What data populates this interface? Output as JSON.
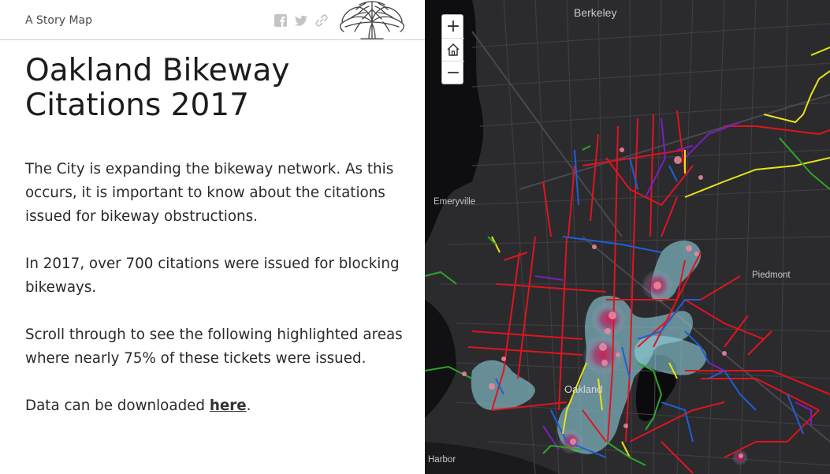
{
  "header": {
    "brand": "A Story Map",
    "share_icons": [
      "facebook-icon",
      "twitter-icon",
      "link-icon"
    ],
    "logo": "oak-tree-logo"
  },
  "story": {
    "title": "Oakland Bikeway Citations 2017",
    "paragraphs": [
      "The City is expanding the bikeway network. As this occurs, it is important to know about the citations issued for bikeway obstructions.",
      "In 2017, over 700 citations were issued for blocking bikeways.",
      "Scroll through to see the following highlighted areas where nearly 75% of these tickets were issued."
    ],
    "download_prefix": "Data can be downloaded ",
    "download_link": "here",
    "download_suffix": "."
  },
  "map": {
    "zoom_in": "+",
    "home": "home-icon",
    "zoom_out": "−",
    "labels": {
      "berkeley": "Berkeley",
      "emeryville": "Emeryville",
      "piedmont": "Piedmont",
      "oakland": "Oakland",
      "harbor": "Harbor"
    },
    "colors": {
      "background": "#2b2b2e",
      "water": "#0e0e10",
      "roads": "#3c3c41",
      "bikeway_red": "#e0141e",
      "bikeway_blue": "#1f5fd6",
      "bikeway_purple": "#7a1fc0",
      "bikeway_yellow": "#e8e317",
      "bikeway_green": "#2fa52a",
      "heatmap_cool": "#8fd0dc",
      "heatmap_hot": "#c0104a"
    }
  }
}
